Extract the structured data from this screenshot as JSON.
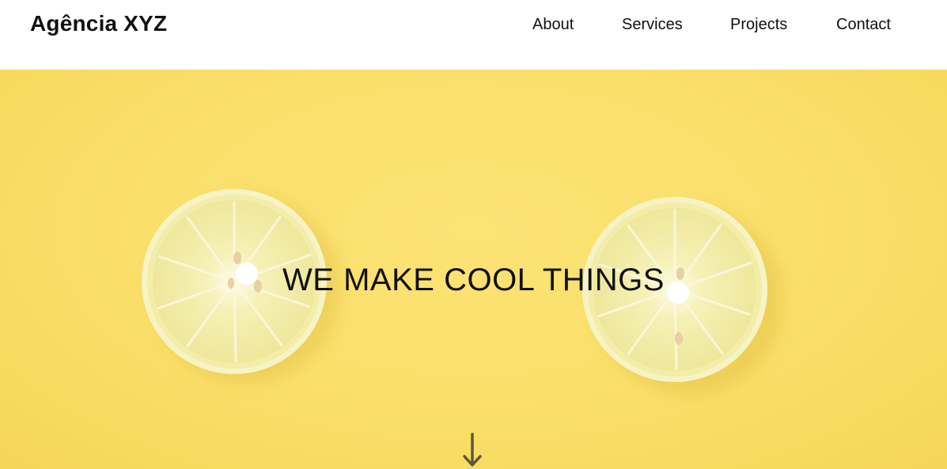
{
  "header": {
    "brand": "Agência XYZ",
    "nav": [
      {
        "label": "About"
      },
      {
        "label": "Services"
      },
      {
        "label": "Projects"
      },
      {
        "label": "Contact"
      }
    ]
  },
  "hero": {
    "title": "WE MAKE COOL THINGS",
    "background_color": "#fadf6a",
    "scroll_icon": "arrow-down-icon"
  }
}
